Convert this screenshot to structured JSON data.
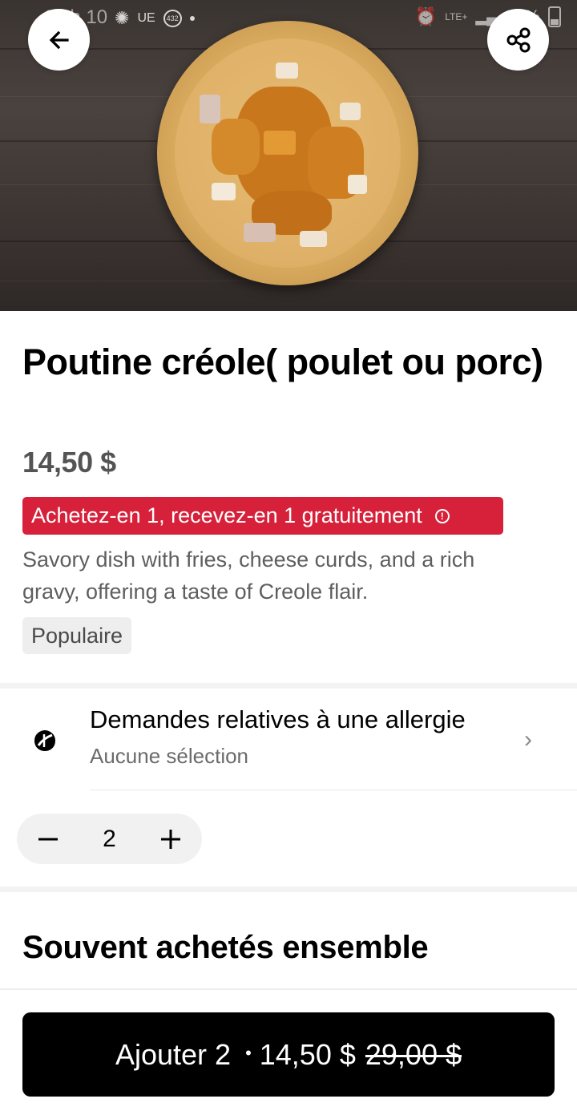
{
  "status_bar": {
    "time": "14 h 10",
    "left_icons": [
      "cbc-icon",
      "ue-icon",
      "432-badge-icon"
    ],
    "ue_label": "UE",
    "badge_label": "432",
    "network": "LTE+",
    "battery": "29%"
  },
  "header": {
    "back_icon": "arrow-left-icon",
    "share_icon": "share-icon"
  },
  "item": {
    "title": "Poutine créole( poulet ou porc)",
    "price": "14,50 $",
    "promo": "Achetez-en 1, recevez-en 1 gratuitement",
    "description": "Savory dish with fries, cheese curds, and a rich gravy, offering a taste of Creole flair.",
    "tag": "Populaire"
  },
  "allergy": {
    "title": "Demandes relatives à une allergie",
    "subtitle": "Aucune sélection"
  },
  "quantity": {
    "value": "2"
  },
  "section": {
    "title": "Souvent achetés ensemble"
  },
  "cta": {
    "label": "Ajouter 2",
    "separator": "•",
    "price": "14,50 $",
    "old_price": "29,00 $"
  },
  "colors": {
    "promo": "#d7213b",
    "cta_bg": "#000000"
  }
}
